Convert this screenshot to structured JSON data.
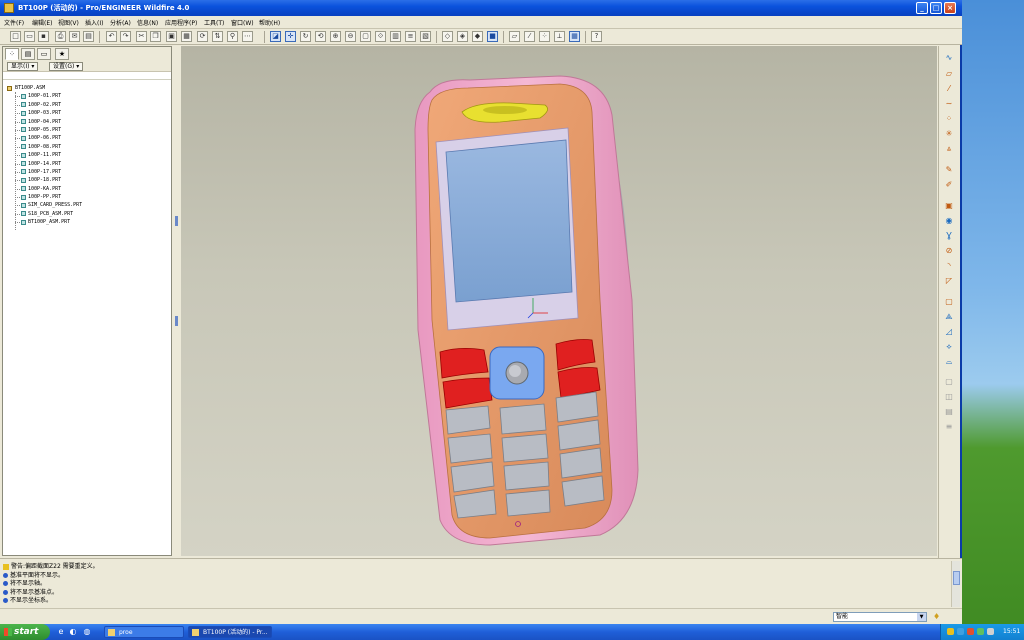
{
  "window": {
    "title": "BT100P (活动的) - Pro/ENGINEER Wildfire 4.0"
  },
  "menu": [
    "文件(F)",
    "编辑(E)",
    "视图(V)",
    "插入(I)",
    "分析(A)",
    "信息(N)",
    "应用程序(P)",
    "工具(T)",
    "窗口(W)",
    "帮助(H)"
  ],
  "left_panel": {
    "show_button": "显示(I) ▾",
    "settings_button": "设置(G) ▾",
    "tree_root": "BT100P.ASM",
    "tree_items": [
      "100P-01.PRT",
      "100P-02.PRT",
      "100P-03.PRT",
      "100P-04.PRT",
      "100P-05.PRT",
      "100P-06.PRT",
      "100P-08.PRT",
      "100P-11.PRT",
      "100P-14.PRT",
      "100P-17.PRT",
      "100P-18.PRT",
      "100P-KA.PRT",
      "100P-PP.PRT",
      "SIM_CARD_PRESS.PRT",
      "S18_PCB_ASM.PRT",
      "BT100P_ASM.PRT"
    ]
  },
  "messages": [
    {
      "text": "警告:偏距截面Z22 需要重定义。",
      "type": "warn"
    },
    {
      "text": "基准平面将不显示。",
      "type": "info"
    },
    {
      "text": "将不显示轴。",
      "type": "info"
    },
    {
      "text": "将不显示基准点。",
      "type": "info"
    },
    {
      "text": "不显示坐标系。",
      "type": "info"
    }
  ],
  "status": {
    "filter_value": "智能"
  },
  "taskbar": {
    "start_label": "start",
    "tasks": [
      {
        "label": "proe",
        "active": false
      },
      {
        "label": "BT100P (活动的) - Pr...",
        "active": true
      }
    ],
    "clock": "15:51"
  },
  "colors": {
    "title_bar": "#0a52dc",
    "phone_body": "#e8a070",
    "phone_shell": "#f0a8c8",
    "screen": "#8aaed8",
    "soft_keys": "#e02020",
    "nav_pad": "#7aa8f0",
    "keypad": "#b8bcc0"
  }
}
